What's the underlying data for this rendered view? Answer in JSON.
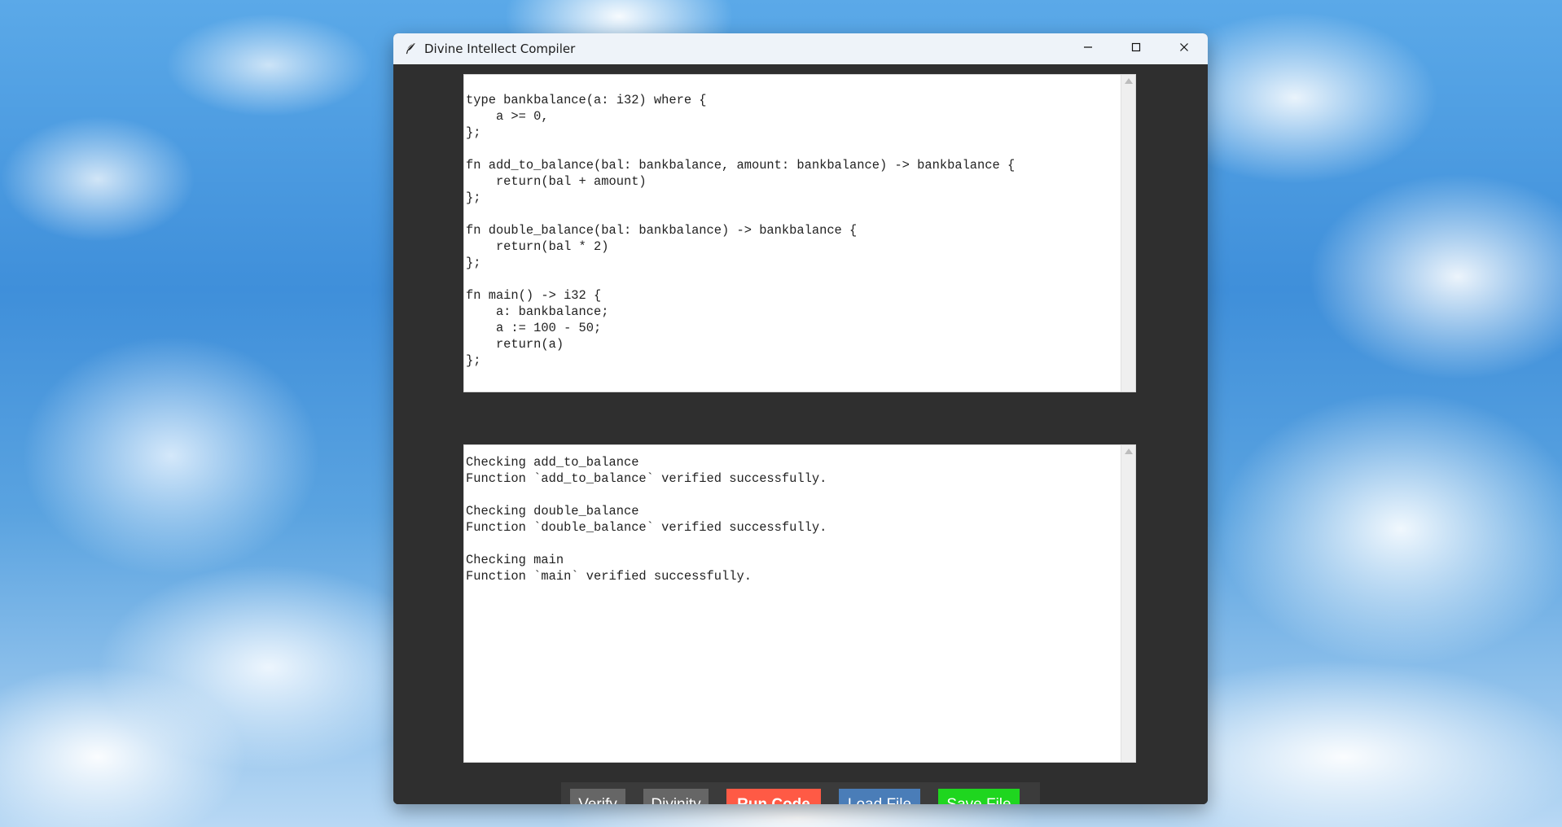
{
  "window": {
    "title": "Divine Intellect Compiler",
    "app_icon": "feather-icon",
    "controls": {
      "minimize": "minimize-icon",
      "maximize": "maximize-icon",
      "close": "close-icon"
    }
  },
  "editor": {
    "code": "type bankbalance(a: i32) where {\n    a >= 0,\n};\n\nfn add_to_balance(bal: bankbalance, amount: bankbalance) -> bankbalance {\n    return(bal + amount)\n};\n\nfn double_balance(bal: bankbalance) -> bankbalance {\n    return(bal * 2)\n};\n\nfn main() -> i32 {\n    a: bankbalance;\n    a := 100 - 50;\n    return(a)\n};"
  },
  "output": {
    "text": "Checking add_to_balance\nFunction `add_to_balance` verified successfully.\n\nChecking double_balance\nFunction `double_balance` verified successfully.\n\nChecking main\nFunction `main` verified successfully."
  },
  "toolbar": {
    "verify_label": "Verify",
    "divinity_label": "Divinity",
    "run_label": "Run Code",
    "load_label": "Load File",
    "save_label": "Save File"
  },
  "colors": {
    "window_bg": "#2f2f2f",
    "toolbar_bg": "#3b3b3b",
    "verify_btn": "#666666",
    "divinity_btn": "#666666",
    "run_btn": "#ff5a45",
    "load_btn": "#4a7db8",
    "save_btn": "#1fd61f"
  }
}
